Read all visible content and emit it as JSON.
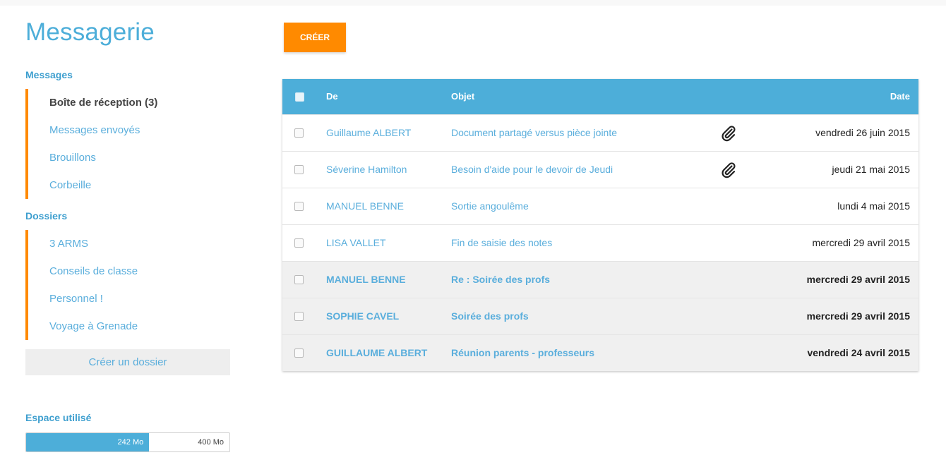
{
  "app": {
    "title": "Messagerie"
  },
  "sidebar": {
    "messages_title": "Messages",
    "messages_items": [
      {
        "label": "Boîte de réception (3)",
        "active": true
      },
      {
        "label": "Messages envoyés",
        "active": false
      },
      {
        "label": "Brouillons",
        "active": false
      },
      {
        "label": "Corbeille",
        "active": false
      }
    ],
    "folders_title": "Dossiers",
    "folder_items": [
      {
        "label": "3 ARMS"
      },
      {
        "label": "Conseils de classe"
      },
      {
        "label": "Personnel !"
      },
      {
        "label": "Voyage à Grenade"
      }
    ],
    "create_folder_label": "Créer un dossier",
    "storage": {
      "title": "Espace utilisé",
      "used_label": "242 Mo",
      "total_label": "400 Mo",
      "used_fraction": 0.605
    }
  },
  "toolbar": {
    "create_label": "CRÉER"
  },
  "table": {
    "headers": {
      "from": "De",
      "subject": "Objet",
      "date": "Date"
    },
    "rows": [
      {
        "from": "Guillaume ALBERT",
        "subject": "Document partagé versus pièce jointe",
        "attachment": true,
        "date": "vendredi 26 juin 2015",
        "unread": false
      },
      {
        "from": "Séverine Hamilton",
        "subject": "Besoin d'aide pour le devoir de Jeudi",
        "attachment": true,
        "date": "jeudi 21 mai 2015",
        "unread": false
      },
      {
        "from": "MANUEL BENNE",
        "subject": "Sortie angoulême",
        "attachment": false,
        "date": "lundi 4 mai 2015",
        "unread": false
      },
      {
        "from": "LISA VALLET",
        "subject": "Fin de saisie des notes",
        "attachment": false,
        "date": "mercredi 29 avril 2015",
        "unread": false
      },
      {
        "from": "MANUEL BENNE",
        "subject": "Re : Soirée des profs",
        "attachment": false,
        "date": "mercredi 29 avril 2015",
        "unread": true
      },
      {
        "from": "SOPHIE CAVEL",
        "subject": "Soirée des profs",
        "attachment": false,
        "date": "mercredi 29 avril 2015",
        "unread": true
      },
      {
        "from": "GUILLAUME ALBERT",
        "subject": "Réunion parents - professeurs",
        "attachment": false,
        "date": "vendredi 24 avril 2015",
        "unread": true
      }
    ]
  },
  "colors": {
    "accent": "#4daed9",
    "orange": "#ff8a00",
    "link": "#5aaedc"
  }
}
